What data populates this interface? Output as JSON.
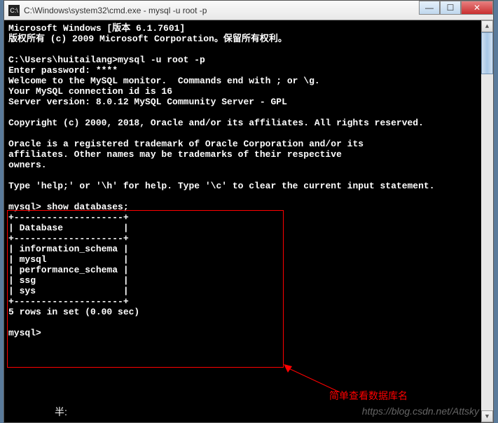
{
  "window": {
    "icon_text": "C:\\",
    "title": "C:\\Windows\\system32\\cmd.exe - mysql  -u root -p"
  },
  "terminal": {
    "line1": "Microsoft Windows [版本 6.1.7601]",
    "line2": "版权所有 (c) 2009 Microsoft Corporation。保留所有权利。",
    "line3": "",
    "line4": "C:\\Users\\huitailang>mysql -u root -p",
    "line5": "Enter password: ****",
    "line6": "Welcome to the MySQL monitor.  Commands end with ; or \\g.",
    "line7": "Your MySQL connection id is 16",
    "line8": "Server version: 8.0.12 MySQL Community Server - GPL",
    "line9": "",
    "line10": "Copyright (c) 2000, 2018, Oracle and/or its affiliates. All rights reserved.",
    "line11": "",
    "line12": "Oracle is a registered trademark of Oracle Corporation and/or its",
    "line13": "affiliates. Other names may be trademarks of their respective",
    "line14": "owners.",
    "line15": "",
    "line16": "Type 'help;' or '\\h' for help. Type '\\c' to clear the current input statement.",
    "line17": "",
    "line18": "mysql> show databases;",
    "line19": "+--------------------+",
    "line20": "| Database           |",
    "line21": "+--------------------+",
    "line22": "| information_schema |",
    "line23": "| mysql              |",
    "line24": "| performance_schema |",
    "line25": "| ssg                |",
    "line26": "| sys                |",
    "line27": "+--------------------+",
    "line28": "5 rows in set (0.00 sec)",
    "line29": "",
    "line30": "mysql>"
  },
  "annotation": {
    "text": "简单查看数据库名"
  },
  "footer": {
    "text": "半:"
  },
  "watermark": {
    "text": "https://blog.csdn.net/Attsky"
  }
}
